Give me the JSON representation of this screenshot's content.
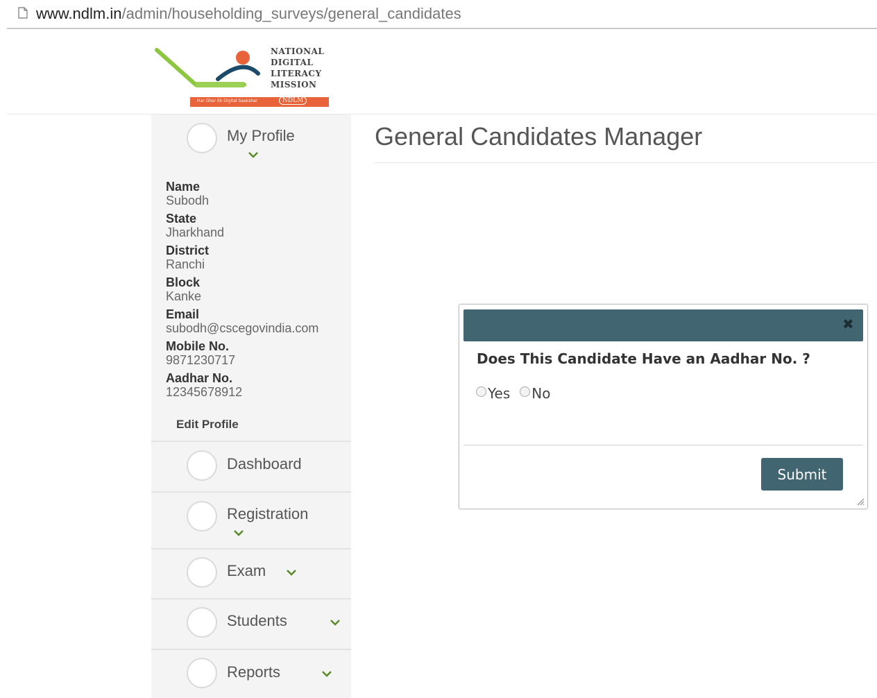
{
  "browser": {
    "url_host": "www.ndlm.in",
    "url_path": "/admin/householding_surveys/general_candidates",
    "page_icon": "document-icon"
  },
  "logo": {
    "lines": [
      "NATIONAL",
      "DIGITAL",
      "LITERACY",
      "MISSION"
    ],
    "band_tag": "Har Ghar Ek Digital Saakshar",
    "badge": "NDLM",
    "colors": {
      "green": "#8dc63f",
      "orange": "#e8623a",
      "blue": "#1b4a6b"
    }
  },
  "sidebar": {
    "profile_title": "My Profile",
    "profile": [
      {
        "label": "Name",
        "value": "Subodh"
      },
      {
        "label": "State",
        "value": "Jharkhand"
      },
      {
        "label": "District",
        "value": "Ranchi"
      },
      {
        "label": "Block",
        "value": "Kanke"
      },
      {
        "label": "Email",
        "value": "subodh@cscegovindia.com"
      },
      {
        "label": "Mobile No.",
        "value": "9871230717"
      },
      {
        "label": "Aadhar No.",
        "value": "12345678912"
      }
    ],
    "edit_profile": "Edit Profile",
    "menu": {
      "dashboard": "Dashboard",
      "registration": "Registration",
      "exam": "Exam",
      "students": "Students",
      "reports": "Reports"
    },
    "chevron_color": "#5a8a2a"
  },
  "main": {
    "title": "General Candidates Manager"
  },
  "dialog": {
    "header_color": "#426572",
    "close_glyph": "✖",
    "question": "Does This Candidate Have an Aadhar No. ?",
    "options": [
      "Yes",
      "No"
    ],
    "selected": null,
    "submit_label": "Submit"
  }
}
